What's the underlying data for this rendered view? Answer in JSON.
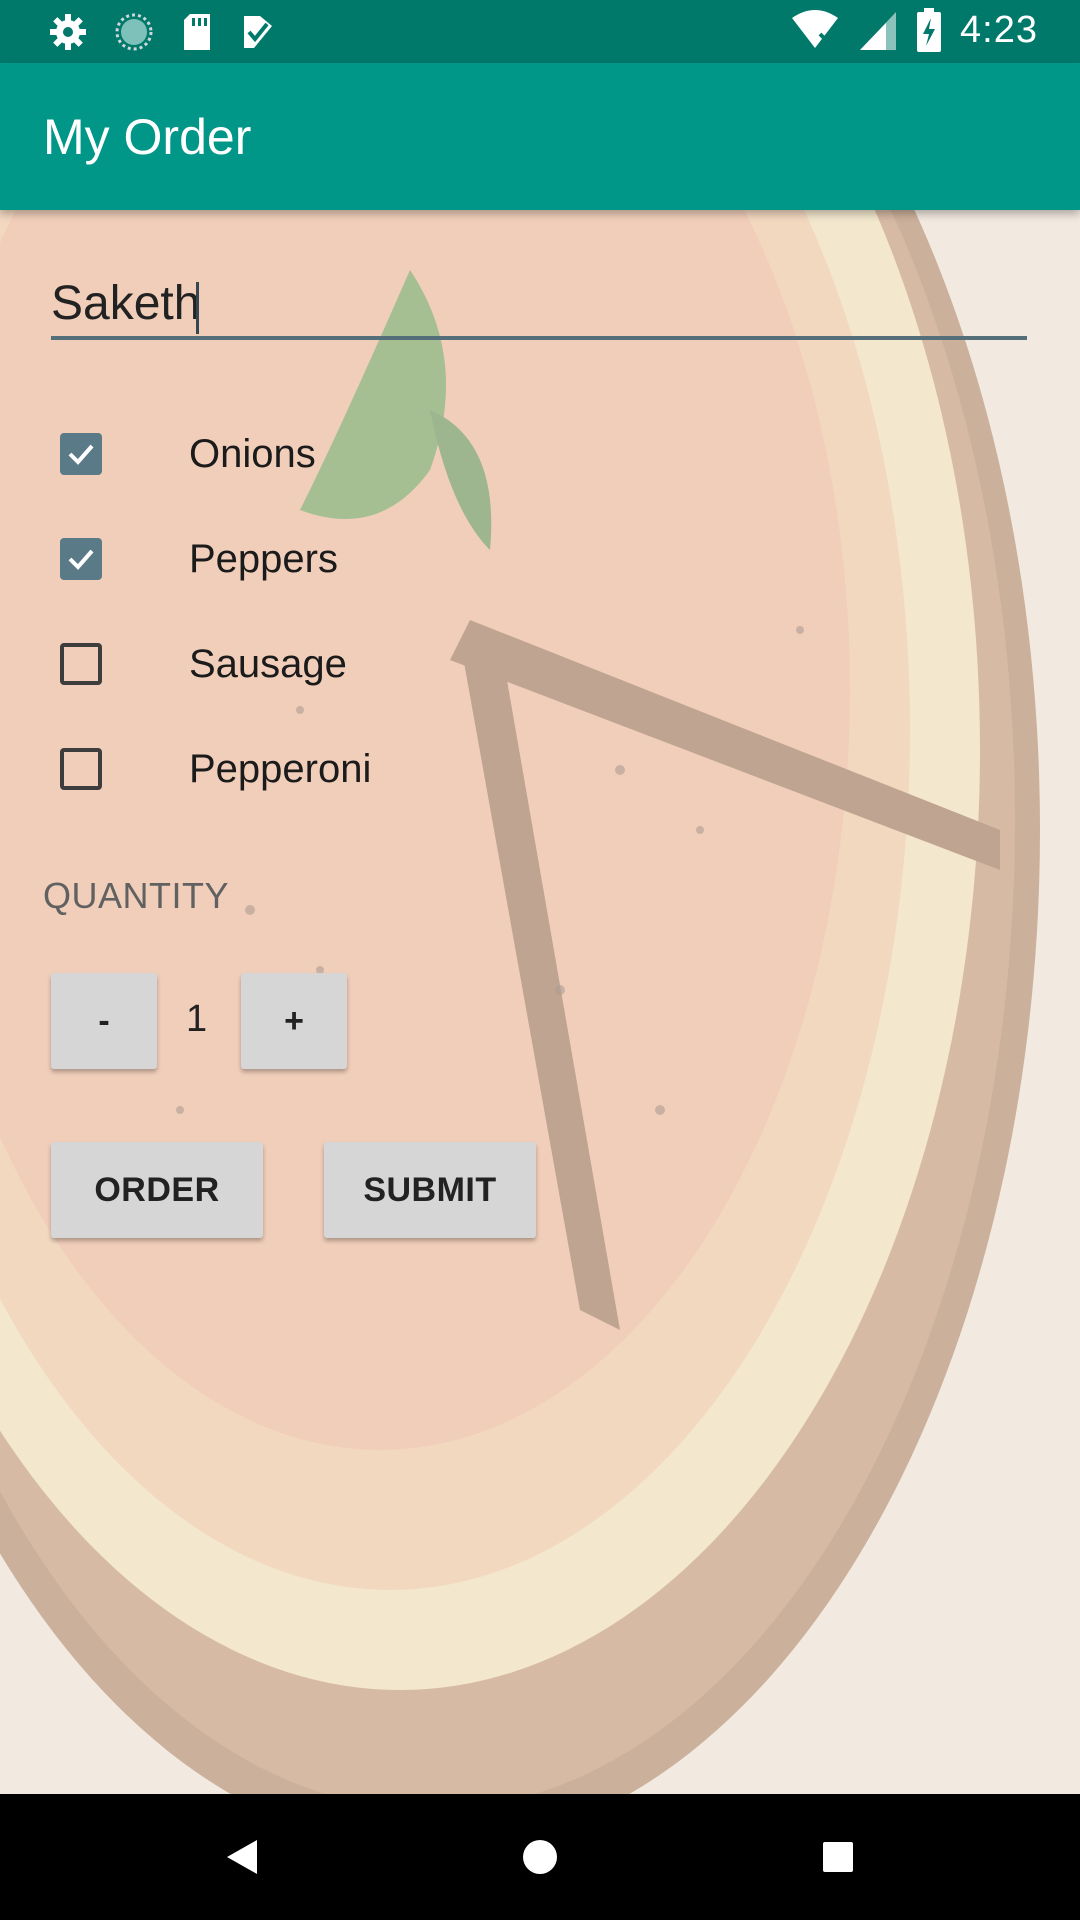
{
  "status_bar": {
    "time": "4:23",
    "left_icons": [
      "settings-icon",
      "sync-icon",
      "sd-card-icon",
      "task-check-icon"
    ],
    "right_icons": [
      "wifi-off-icon",
      "signal-icon",
      "battery-charging-icon"
    ]
  },
  "app_bar": {
    "title": "My Order",
    "color": "#009688"
  },
  "form": {
    "name_value": "Saketh",
    "toppings": [
      {
        "label": "Onions",
        "checked": true
      },
      {
        "label": "Peppers",
        "checked": true
      },
      {
        "label": "Sausage",
        "checked": false
      },
      {
        "label": "Pepperoni",
        "checked": false
      }
    ],
    "quantity_heading": "QUANTITY",
    "decrement_label": "-",
    "increment_label": "+",
    "quantity_value": "1",
    "order_label": "ORDER",
    "submit_label": "SUBMIT"
  },
  "nav_bar": {
    "buttons": [
      "back-icon",
      "home-icon",
      "recents-icon"
    ]
  }
}
